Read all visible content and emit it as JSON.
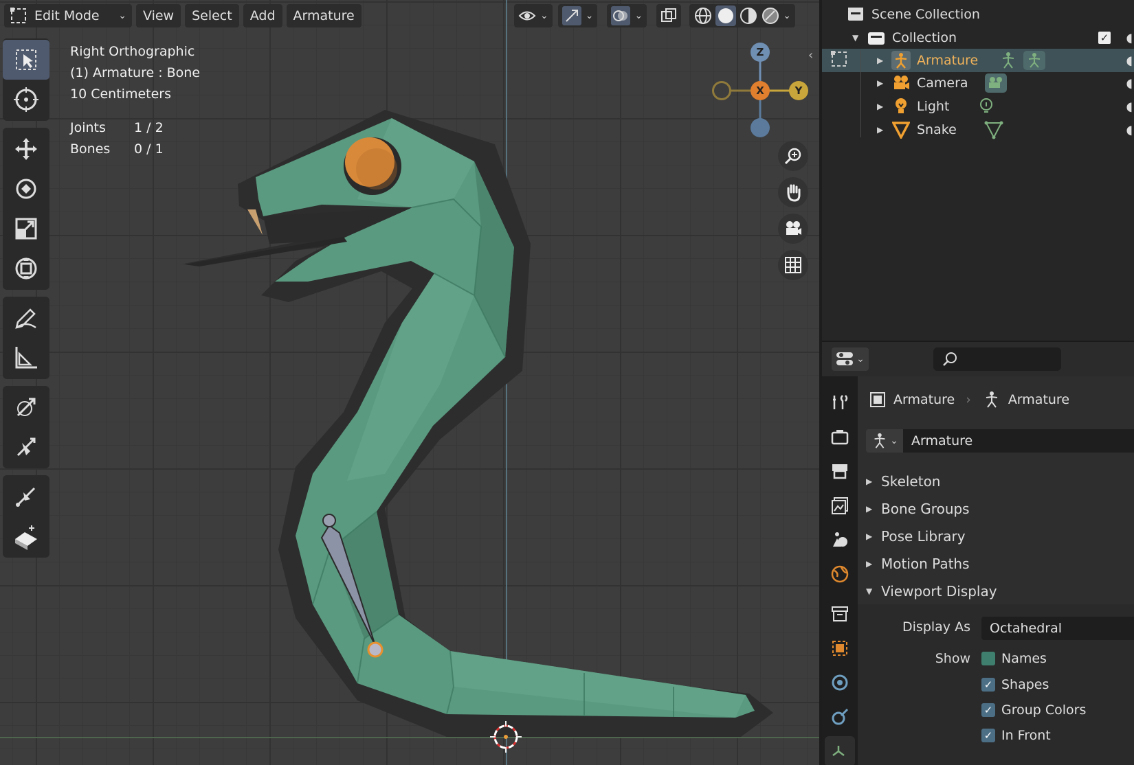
{
  "header": {
    "mode": "Edit Mode",
    "menus": [
      "View",
      "Select",
      "Add",
      "Armature"
    ]
  },
  "viewport": {
    "view_name": "Right Orthographic",
    "object_info": "(1) Armature : Bone",
    "scale": "10 Centimeters",
    "stats": [
      {
        "label": "Joints",
        "value": "1 / 2"
      },
      {
        "label": "Bones",
        "value": "0 / 1"
      }
    ],
    "gizmo": {
      "z": "Z",
      "x": "X",
      "y": "Y"
    },
    "colors": {
      "snake_body": "#5a9a80",
      "snake_shadow": "#2e2e2e",
      "eye": "#d88a3a",
      "bone": "#8c93a6",
      "axis_x": "#e07f2e",
      "axis_y": "#c9a63b",
      "axis_z": "#6f8fb3"
    }
  },
  "outliner": {
    "root": "Scene Collection",
    "collection": "Collection",
    "items": [
      {
        "label": "Armature",
        "icon": "armature-icon",
        "selected": true
      },
      {
        "label": "Camera",
        "icon": "camera-icon",
        "selected": false
      },
      {
        "label": "Light",
        "icon": "light-icon",
        "selected": false
      },
      {
        "label": "Snake",
        "icon": "mesh-icon",
        "selected": false
      }
    ]
  },
  "properties": {
    "search_placeholder": "",
    "breadcrumb_object": "Armature",
    "breadcrumb_data": "Armature",
    "data_name": "Armature",
    "panels": [
      "Skeleton",
      "Bone Groups",
      "Pose Library",
      "Motion Paths",
      "Viewport Display"
    ],
    "viewport_display": {
      "display_as_label": "Display As",
      "display_as_value": "Octahedral",
      "show_label": "Show",
      "options": [
        {
          "label": "Names",
          "checked": false
        },
        {
          "label": "Shapes",
          "checked": true
        },
        {
          "label": "Group Colors",
          "checked": true
        },
        {
          "label": "In Front",
          "checked": true
        }
      ]
    }
  }
}
